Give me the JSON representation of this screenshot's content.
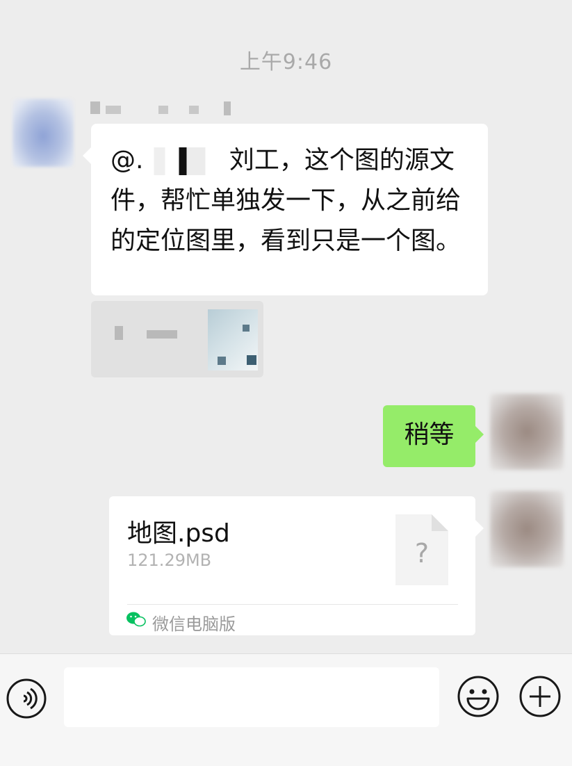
{
  "chat": {
    "timestamp": "上午9:46",
    "incoming_message": {
      "prefix": "@.",
      "body": "刘工，这个图的源文件，帮忙单独发一下，从之前给的定位图里，看到只是一个图。"
    },
    "reply_message": "稍等",
    "file_message": {
      "file_name": "地图.psd",
      "file_size": "121.29MB",
      "file_icon_glyph": "?",
      "source_label": "微信电脑版"
    }
  },
  "input_bar": {
    "input_value": "",
    "icons": [
      "voice-icon",
      "emoji-icon",
      "plus-icon"
    ]
  },
  "colors": {
    "chat_background": "#ededed",
    "outgoing_bubble": "#95ec69",
    "incoming_bubble": "#ffffff",
    "wechat_green": "#07c160"
  }
}
